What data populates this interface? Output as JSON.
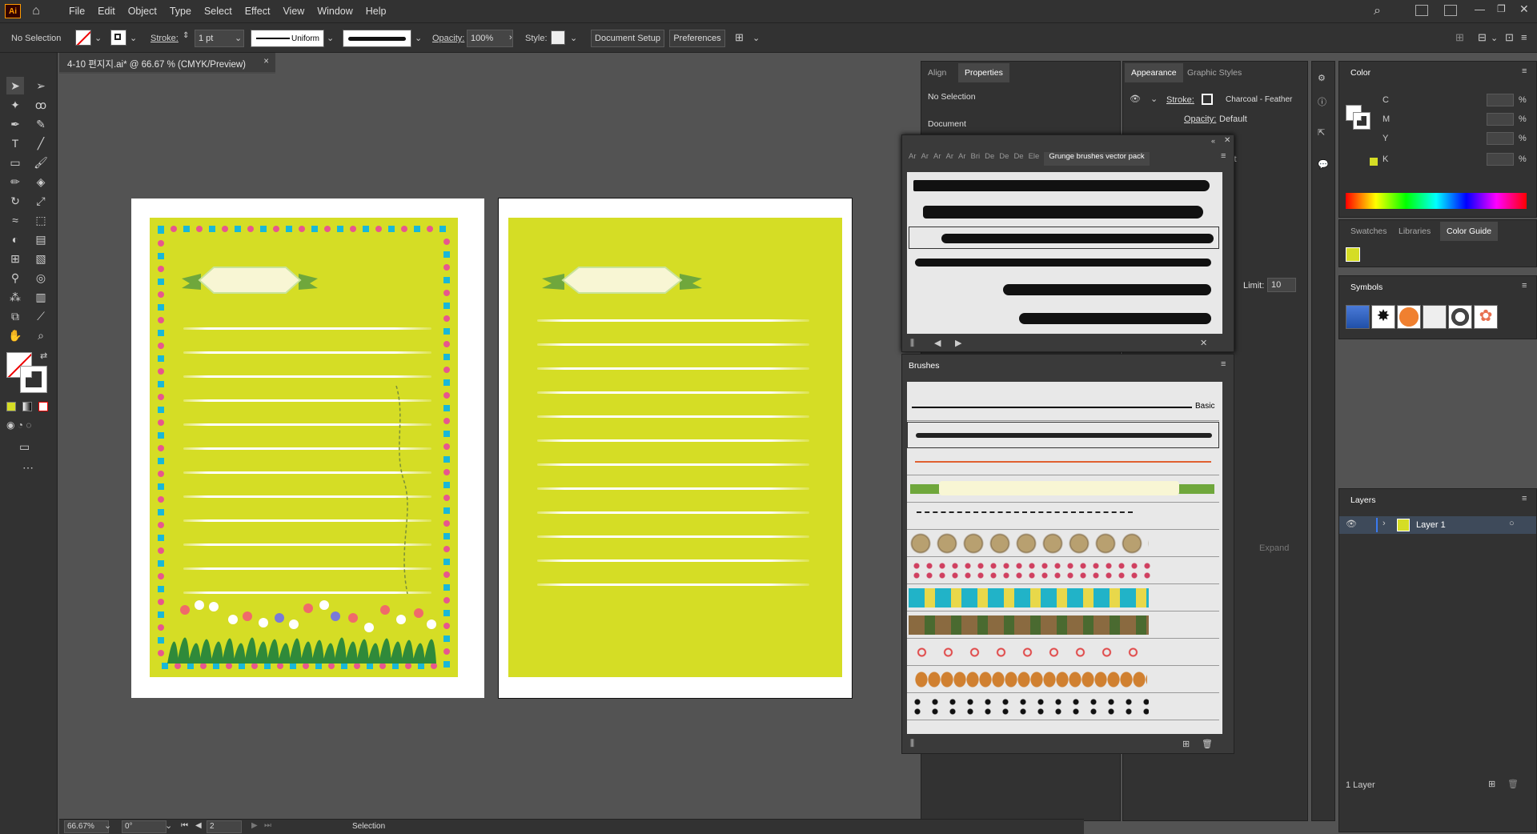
{
  "app": {
    "logo": "Ai",
    "home_icon": "home-icon"
  },
  "menu": [
    "File",
    "Edit",
    "Object",
    "Type",
    "Select",
    "Effect",
    "View",
    "Window",
    "Help"
  ],
  "control": {
    "selection": "No Selection",
    "stroke_label": "Stroke:",
    "stroke_weight": "1 pt",
    "profile": "Uniform",
    "opacity_label": "Opacity:",
    "opacity": "100%",
    "style_label": "Style:",
    "document_setup": "Document Setup",
    "preferences": "Preferences"
  },
  "document": {
    "tab_title": "4-10 편지지.ai* @ 66.67 % (CMYK/Preview)",
    "close": "×"
  },
  "status": {
    "zoom": "66.67%",
    "rotation": "0°",
    "artboard": "2",
    "tool": "Selection"
  },
  "props_panel": {
    "tabs": [
      "Align",
      "Properties"
    ],
    "active_tab": "Properties",
    "no_selection": "No Selection",
    "document": "Document",
    "limit_label": "Limit:",
    "limit_value": "10",
    "expand": "Expand"
  },
  "appearance_panel": {
    "tabs": [
      "Appearance",
      "Graphic Styles"
    ],
    "stroke_label": "Stroke:",
    "stroke_value": "Charcoal - Feather",
    "opacity_label": "Opacity:",
    "opacity_value": "Default",
    "fx_row": "ult"
  },
  "grunge_panel": {
    "tabs": [
      "Ar",
      "Ar",
      "Ar",
      "Ar",
      "Ar",
      "Bri",
      "De",
      "De",
      "De",
      "Ele"
    ],
    "active_tab": "Grunge brushes vector pack"
  },
  "brushes_panel": {
    "title": "Brushes",
    "basic_label": "Basic"
  },
  "color_panel": {
    "title": "Color",
    "channels": [
      {
        "name": "C",
        "value": ""
      },
      {
        "name": "M",
        "value": ""
      },
      {
        "name": "Y",
        "value": ""
      },
      {
        "name": "K",
        "value": ""
      }
    ],
    "unit": "%"
  },
  "swatch_tabs": {
    "tabs": [
      "Swatches",
      "Libraries",
      "Color Guide"
    ],
    "active": "Color Guide"
  },
  "symbols_panel": {
    "title": "Symbols"
  },
  "layers_panel": {
    "title": "Layers",
    "layer_name": "Layer 1",
    "count": "1 Layer"
  },
  "colors": {
    "paper": "#d5dd25",
    "accent_pink": "#e8568e",
    "accent_cyan": "#18b8d8",
    "ribbon": "#f8f6d4",
    "ribbon_green": "#6fa73c"
  }
}
